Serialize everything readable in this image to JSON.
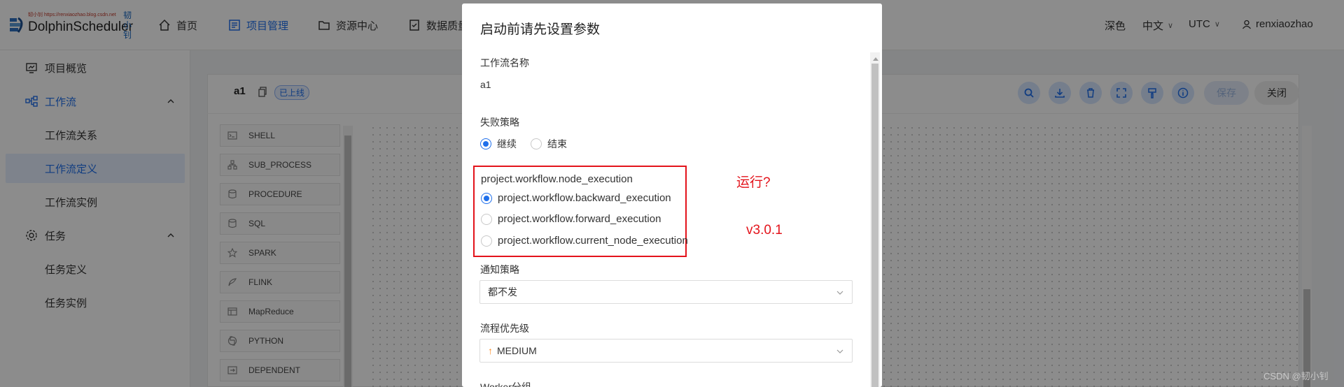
{
  "header": {
    "logo_url_text": "韧小钊  https://renxiaozhao.blog.csdn.net",
    "logo_text": "DolphinScheduler",
    "logo_cn": "韧小钊",
    "nav": [
      {
        "label": "首页",
        "icon": "home-icon"
      },
      {
        "label": "项目管理",
        "icon": "project-icon"
      },
      {
        "label": "资源中心",
        "icon": "folder-icon"
      },
      {
        "label": "数据质量",
        "icon": "data-quality-icon"
      }
    ],
    "theme": "深色",
    "language": "中文",
    "timezone": "UTC",
    "user": "renxiaozhao"
  },
  "sidebar": {
    "items": [
      {
        "label": "项目概览",
        "icon": "overview-icon"
      },
      {
        "label": "工作流",
        "icon": "workflow-icon"
      },
      {
        "label": "工作流关系"
      },
      {
        "label": "工作流定义"
      },
      {
        "label": "工作流实例"
      },
      {
        "label": "任务",
        "icon": "gear-icon"
      },
      {
        "label": "任务定义"
      },
      {
        "label": "任务实例"
      }
    ]
  },
  "canvas": {
    "workflow_name": "a1",
    "status_tag": "已上线",
    "save_label": "保存",
    "close_label": "关闭",
    "tasks": [
      "SHELL",
      "SUB_PROCESS",
      "PROCEDURE",
      "SQL",
      "SPARK",
      "FLINK",
      "MapReduce",
      "PYTHON",
      "DEPENDENT"
    ]
  },
  "modal": {
    "title": "启动前请先设置参数",
    "workflow_name_label": "工作流名称",
    "workflow_name_value": "a1",
    "failure_strategy_label": "失败策略",
    "failure_options": [
      "继续",
      "结束"
    ],
    "failure_selected": "继续",
    "node_execution_label": "project.workflow.node_execution",
    "node_execution_options": [
      "project.workflow.backward_execution",
      "project.workflow.forward_execution",
      "project.workflow.current_node_execution"
    ],
    "node_execution_selected": "project.workflow.backward_execution",
    "notify_label": "通知策略",
    "notify_value": "都不发",
    "priority_label": "流程优先级",
    "priority_value": "MEDIUM",
    "worker_group_label": "Worker分组"
  },
  "annotations": {
    "question": "运行?",
    "version": "v3.0.1"
  },
  "watermark": "CSDN @韧小钊",
  "colors": {
    "accent": "#1f6feb",
    "annotation_red": "#e3131b",
    "priority_orange": "#ff8a1e"
  }
}
